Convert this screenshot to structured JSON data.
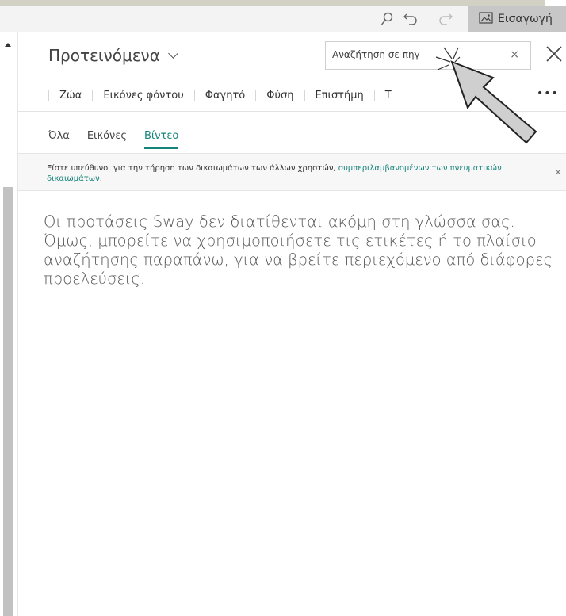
{
  "toolbar": {
    "icons": [
      "search-icon",
      "undo-icon",
      "redo-icon"
    ],
    "insert_label": "Εισαγωγή",
    "insert_icon": "image-icon"
  },
  "panel": {
    "title": "Προτεινόμενα",
    "search": {
      "value": "Αναζήτηση σε πηγ",
      "clear_label": "×"
    },
    "categories": [
      "Ζώα",
      "Εικόνες φόντου",
      "Φαγητό",
      "Φύση",
      "Επιστήμη",
      "Τ"
    ],
    "more_label": "•••",
    "tabs": [
      {
        "label": "Όλα",
        "active": false
      },
      {
        "label": "Εικόνες",
        "active": false
      },
      {
        "label": "Βίντεο",
        "active": true
      }
    ],
    "notice": {
      "text": "Είστε υπεύθυνοι για την τήρηση των δικαιωμάτων των άλλων χρηστών, ",
      "link": "συμπεριλαμβανομένων των πνευματικών δικαιωμάτων",
      "tail": ".",
      "close_label": "×"
    },
    "message": "Οι προτάσεις Sway δεν διατίθενται ακόμη στη γλώσσα σας. Όμως, μπορείτε να χρησιμοποιήσετε τις ετικέτες ή το πλαίσιο αναζήτησης παραπάνω, για να βρείτε περιεχόμενο από διάφορες προελεύσεις."
  },
  "colors": {
    "accent": "#16847a",
    "toolbar_bg": "#f3f3f3",
    "top_band": "#d3d1c3",
    "insert_bg": "#c7c7c7"
  }
}
